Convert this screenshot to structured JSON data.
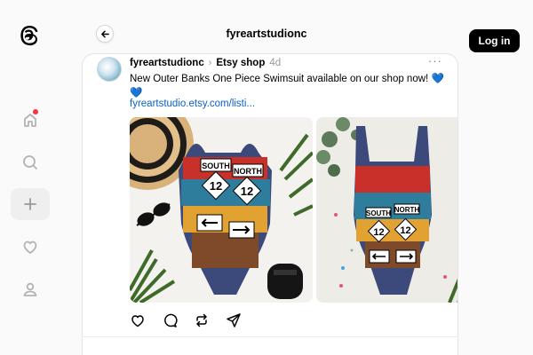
{
  "header": {
    "title": "fyreartstudionc",
    "login_label": "Log in"
  },
  "nav": [
    {
      "icon": "home-icon",
      "notification": true
    },
    {
      "icon": "search-icon"
    },
    {
      "icon": "create-icon"
    },
    {
      "icon": "heart-icon"
    },
    {
      "icon": "profile-icon"
    }
  ],
  "post": {
    "username": "fyreartstudionc",
    "separator": "›",
    "topic": "Etsy shop",
    "time": "4d",
    "text": "New Outer Banks One Piece Swimsuit available on our shop now!",
    "emoji": "💙",
    "emoji2": "💙",
    "link": "fyreartstudio.etsy.com/listi...",
    "images": [
      {
        "alt": "swimsuit-flatlay",
        "signs": [
          "SOUTH",
          "NORTH",
          "12",
          "12"
        ]
      },
      {
        "alt": "swimsuit-hanging",
        "signs": [
          "SOUTH",
          "NORTH",
          "12",
          "12"
        ]
      }
    ]
  },
  "colors": {
    "accent": "#000000",
    "link": "#0a61c4",
    "notification": "#ff3040"
  }
}
